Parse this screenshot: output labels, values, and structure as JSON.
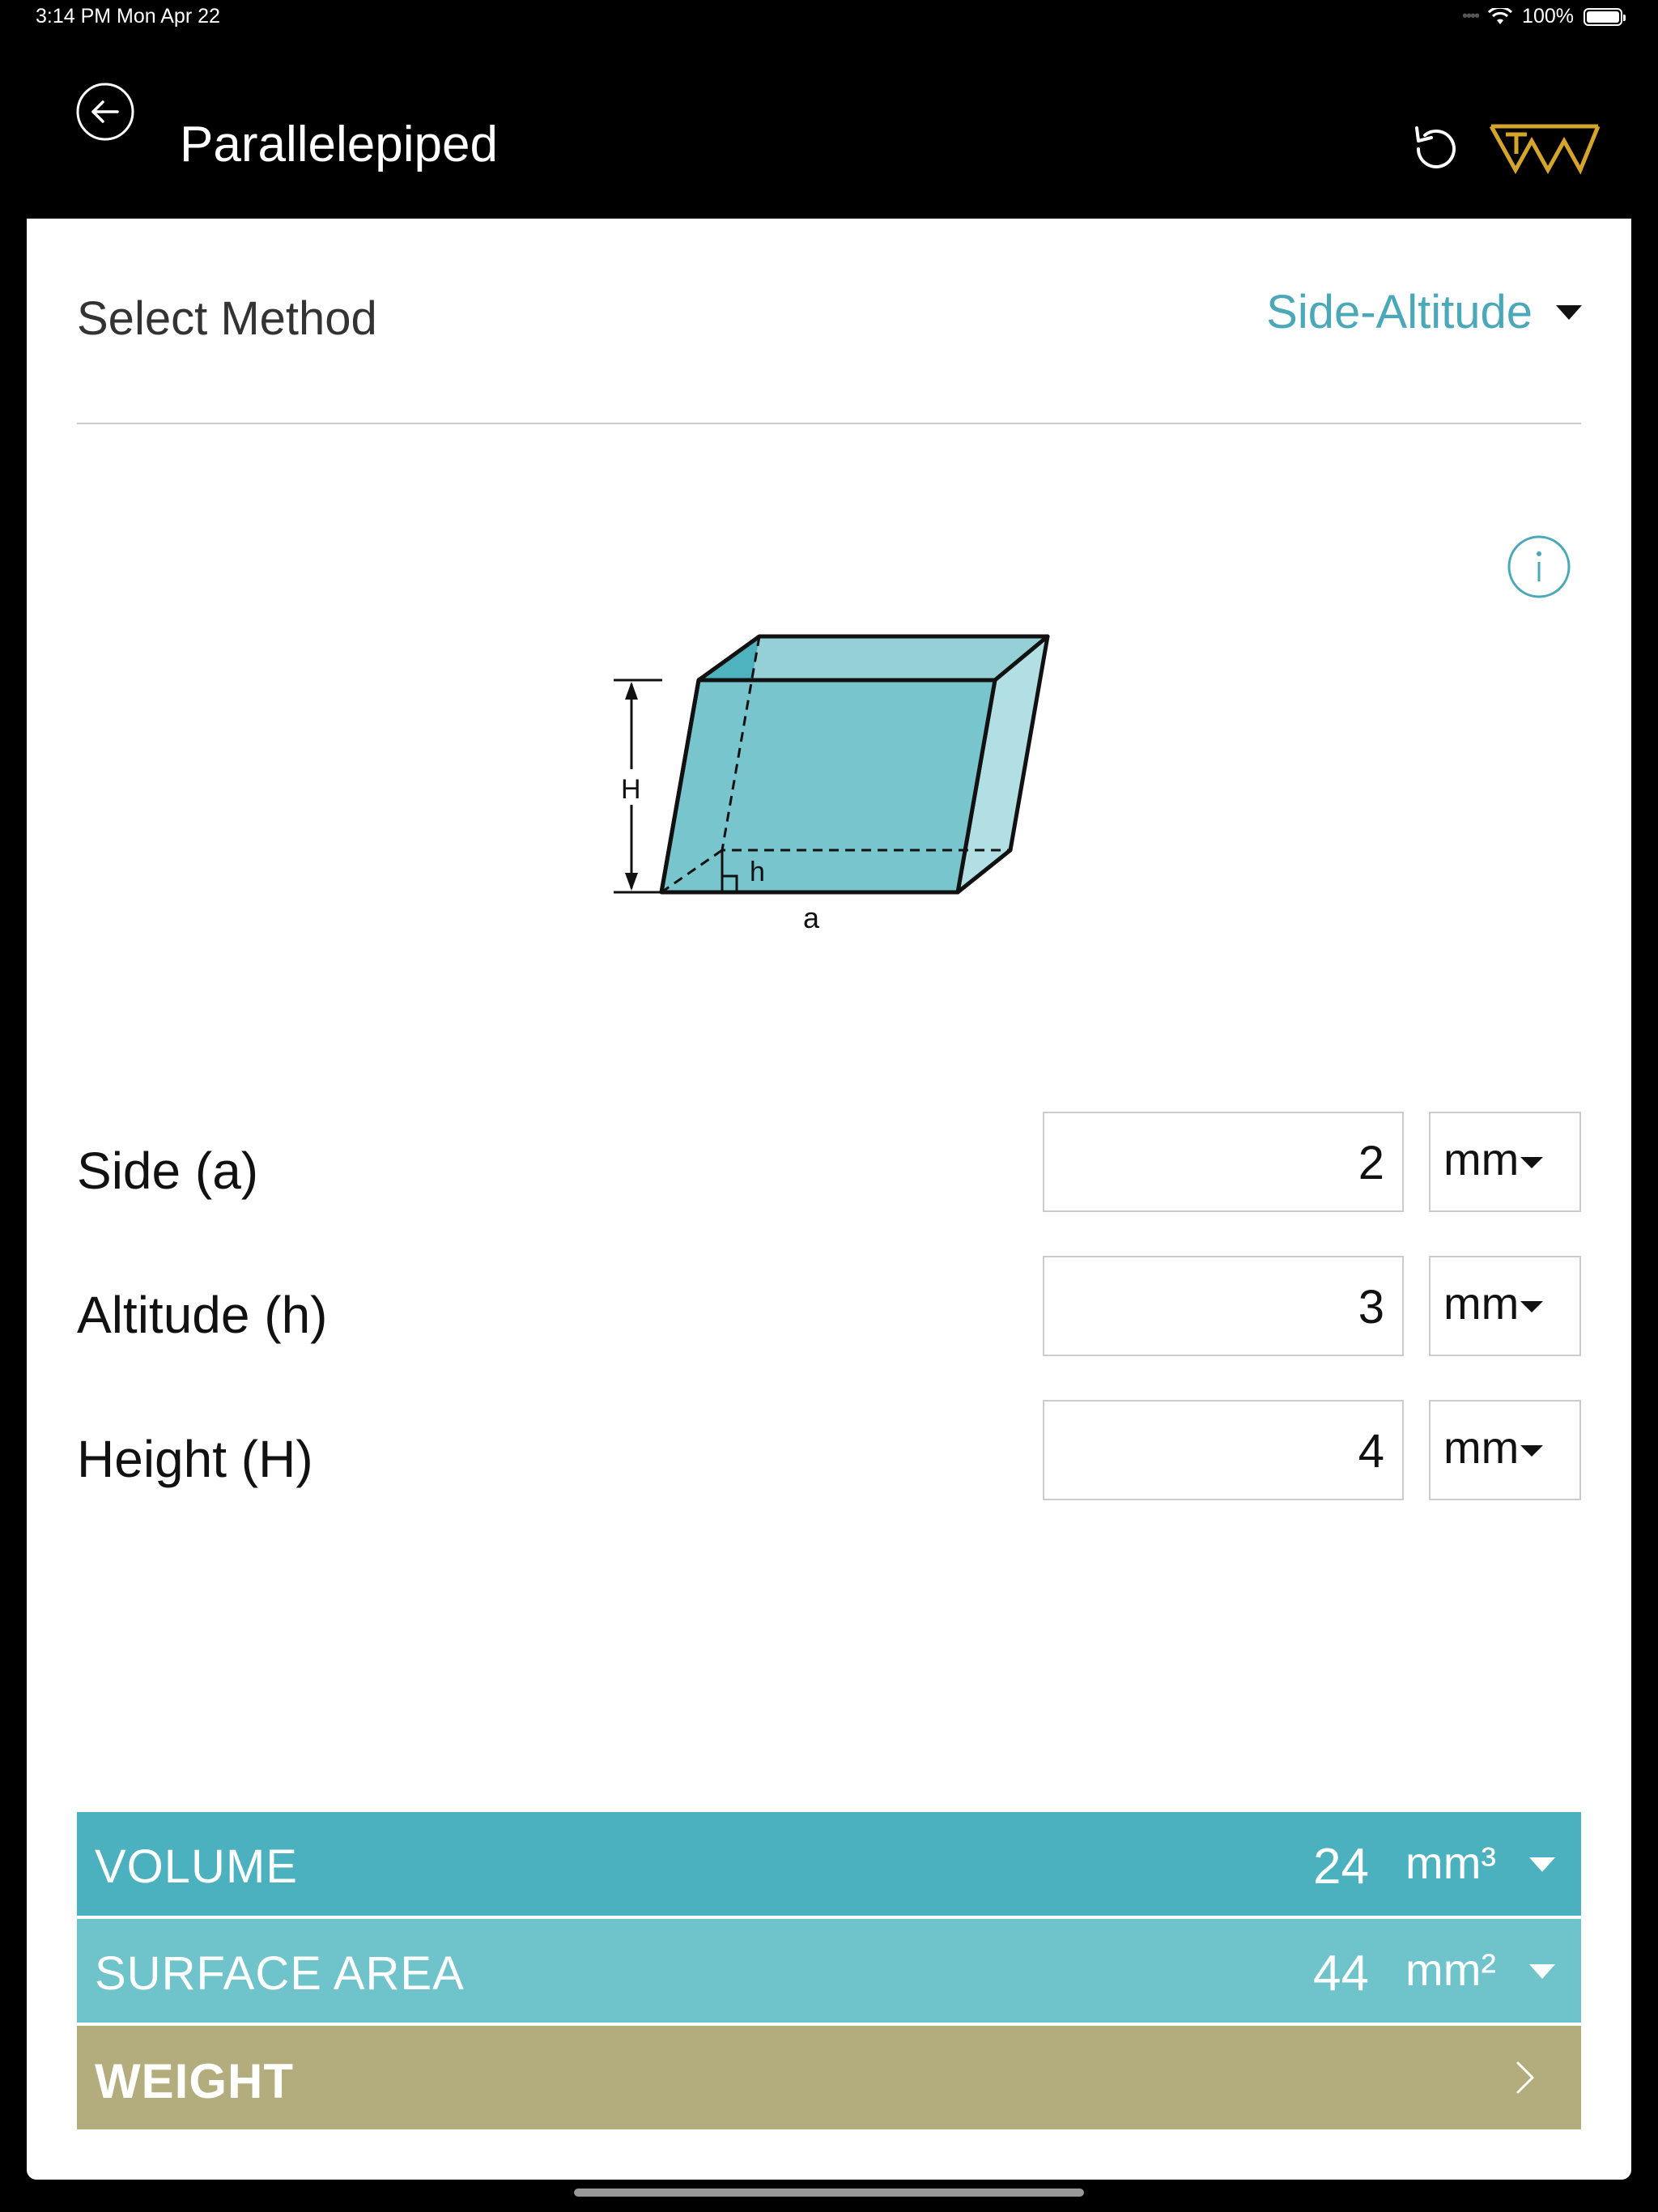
{
  "status_bar": {
    "time": "3:14 PM   Mon Apr 22",
    "battery": "100%"
  },
  "header": {
    "title": "Parallelepiped"
  },
  "method": {
    "label": "Select Method",
    "value": "Side-Altitude"
  },
  "diagram": {
    "label_H": "H",
    "label_h": "h",
    "label_a": "a"
  },
  "inputs": [
    {
      "label": "Side (a)",
      "value": "2",
      "unit": "mm"
    },
    {
      "label": "Altitude (h)",
      "value": "3",
      "unit": "mm"
    },
    {
      "label": "Height (H)",
      "value": "4",
      "unit": "mm"
    }
  ],
  "results": {
    "volume": {
      "label": "VOLUME",
      "value": "24",
      "unit": "mm³"
    },
    "surface_area": {
      "label": "SURFACE AREA",
      "value": "44",
      "unit": "mm²"
    },
    "weight": {
      "label": "WEIGHT"
    }
  },
  "colors": {
    "accent": "#4aa8b8",
    "volume_bar": "#4cb1bf",
    "surface_bar": "#6fc3ca",
    "weight_bar": "#b3ad7d",
    "logo": "#d4a52a"
  }
}
